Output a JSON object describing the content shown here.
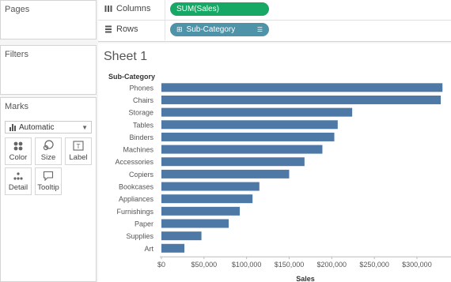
{
  "panels": {
    "pages_title": "Pages",
    "filters_title": "Filters",
    "marks_title": "Marks",
    "mark_type": "Automatic"
  },
  "marks_cards": [
    {
      "label": "Color",
      "icon": "color-dots-icon"
    },
    {
      "label": "Size",
      "icon": "size-icon"
    },
    {
      "label": "Label",
      "icon": "label-icon"
    },
    {
      "label": "Detail",
      "icon": "detail-dots-icon"
    },
    {
      "label": "Tooltip",
      "icon": "tooltip-icon"
    }
  ],
  "shelves": {
    "columns_label": "Columns",
    "columns_pill": "SUM(Sales)",
    "rows_label": "Rows",
    "rows_pill": "Sub-Category"
  },
  "sheet": {
    "title": "Sheet 1"
  },
  "colors": {
    "bar": "#4e79a7",
    "columns_pill": "#16a864",
    "rows_pill": "#4f93a9"
  },
  "chart_data": {
    "type": "bar",
    "orientation": "horizontal",
    "row_header": "Sub-Category",
    "categories": [
      "Phones",
      "Chairs",
      "Storage",
      "Tables",
      "Binders",
      "Machines",
      "Accessories",
      "Copiers",
      "Bookcases",
      "Appliances",
      "Furnishings",
      "Paper",
      "Supplies",
      "Art"
    ],
    "values": [
      330000,
      328000,
      224000,
      207000,
      203000,
      189000,
      168000,
      150000,
      115000,
      107000,
      92000,
      79000,
      47000,
      27000
    ],
    "xlabel": "Sales",
    "xlim": [
      0,
      340000
    ],
    "ticks": [
      0,
      50000,
      100000,
      150000,
      200000,
      250000,
      300000
    ],
    "tick_labels": [
      "$0",
      "$50,000",
      "$100,000",
      "$150,000",
      "$200,000",
      "$250,000",
      "$300,000"
    ],
    "grid": false
  }
}
